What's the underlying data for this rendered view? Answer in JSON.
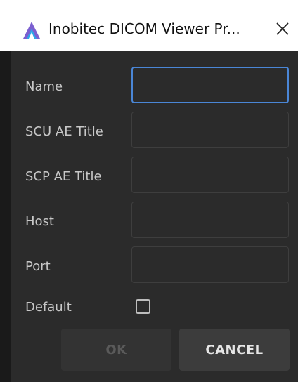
{
  "window": {
    "title": "Inobitec DICOM Viewer Pr...",
    "close_glyph": "✕"
  },
  "form": {
    "name_label": "Name",
    "name_value": "",
    "scu_label": "SCU AE Title",
    "scu_value": "",
    "scp_label": "SCP AE Title",
    "scp_value": "",
    "host_label": "Host",
    "host_value": "",
    "port_label": "Port",
    "port_value": "",
    "default_label": "Default",
    "default_checked": false
  },
  "buttons": {
    "ok_label": "OK",
    "cancel_label": "CANCEL"
  },
  "colors": {
    "accent": "#4a86d6",
    "icon_purple": "#7b5fd0",
    "icon_blue": "#2ea7e6"
  }
}
